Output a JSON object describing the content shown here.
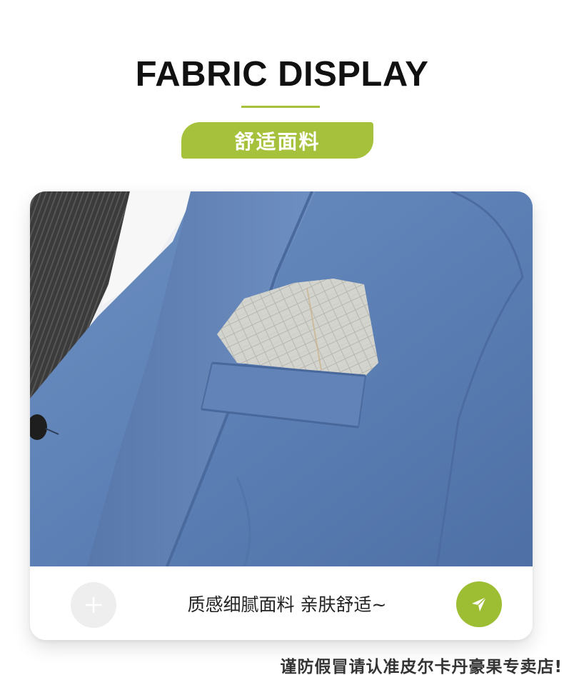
{
  "header": {
    "title": "FABRIC DISPLAY",
    "subtitle_pill": "舒适面料"
  },
  "card": {
    "photo_alt": "blue suit jacket with pocket square",
    "caption": "质感细腻面料 亲肤舒适~",
    "plus_icon": "plus-icon",
    "send_icon": "send-icon"
  },
  "footer": {
    "notice": "谨防假冒请认准皮尔卡丹豪果专卖店!"
  },
  "colors": {
    "accent": "#a6c23c",
    "send_button": "#9dbd32",
    "plus_button": "#eeeeee",
    "suit_blue": "#5b7fb4"
  }
}
